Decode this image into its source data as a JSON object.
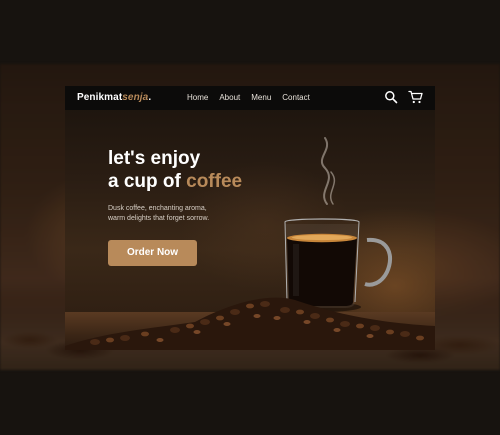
{
  "header": {
    "brand_main": "Penikmat",
    "brand_accent": "senja",
    "brand_suffix": ".",
    "nav_items": [
      "Home",
      "About",
      "Menu",
      "Contact"
    ],
    "icons": [
      "search-icon",
      "cart-icon"
    ]
  },
  "hero": {
    "title_line1": "let's enjoy",
    "title_line2_prefix": "a cup of ",
    "title_line2_accent": "coffee",
    "subtitle_line1": "Dusk coffee, enchanting aroma,",
    "subtitle_line2": "warm delights that forget sorrow.",
    "cta_label": "Order Now"
  },
  "colors": {
    "accent": "#b88a5a",
    "nav_bg": "#0c0b0a",
    "page_bg": "#17130f"
  }
}
